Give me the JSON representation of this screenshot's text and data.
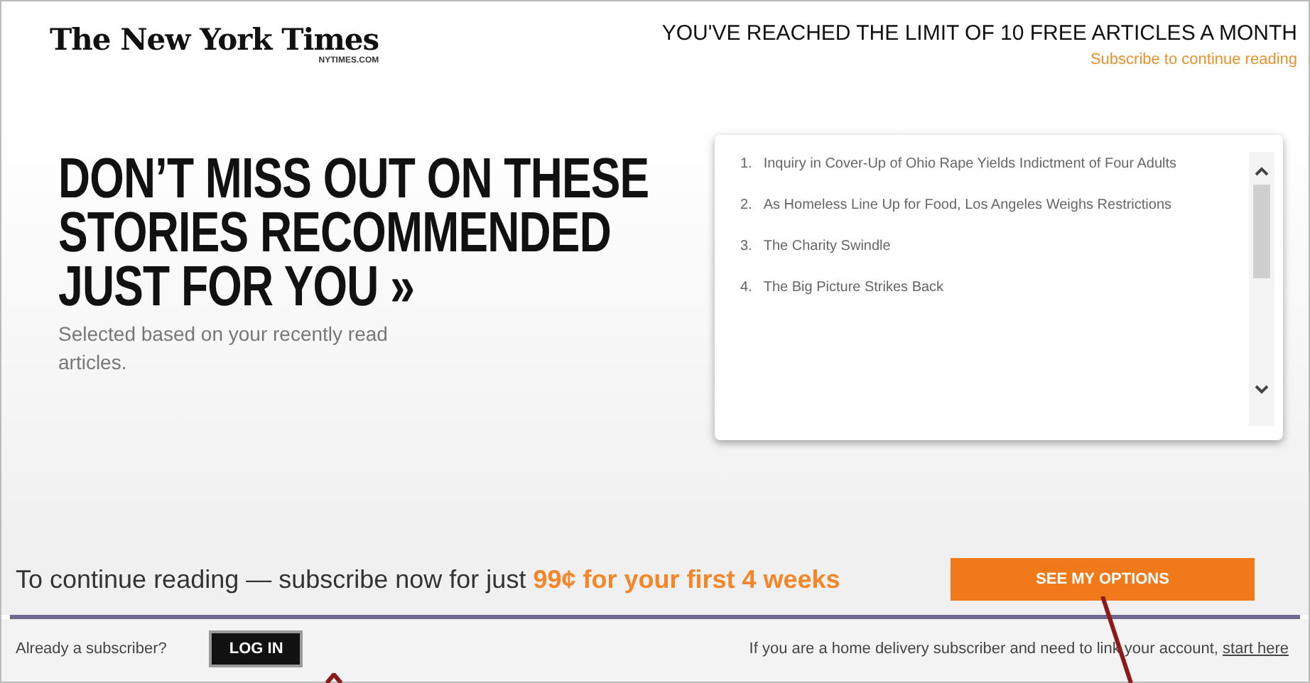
{
  "header": {
    "logo": "The New York Times",
    "logo_sub": "NYTIMES.COM",
    "limit_notice": "YOU'VE REACHED THE LIMIT OF 10 FREE ARTICLES A MONTH",
    "subscribe_link": "Subscribe to continue reading"
  },
  "promo": {
    "headline": "DON’T MISS OUT ON THESE STORIES RECOMMENDED JUST FOR YOU",
    "chevrons": "»",
    "subtitle": "Selected based on your recently read articles."
  },
  "recommended": [
    {
      "number": "1.",
      "title": "Inquiry in Cover-Up of Ohio Rape Yields Indictment of Four Adults"
    },
    {
      "number": "2.",
      "title": "As Homeless Line Up for Food, Los Angeles Weighs Restrictions"
    },
    {
      "number": "3.",
      "title": "The Charity Swindle"
    },
    {
      "number": "4.",
      "title": "The Big Picture Strikes Back"
    }
  ],
  "offer": {
    "text": "To continue reading — subscribe now for just ",
    "highlight": "99¢ for your first 4 weeks",
    "button": "SEE MY OPTIONS"
  },
  "footer": {
    "subscriber_question": "Already a subscriber?",
    "login_button": "LOG IN",
    "delivery_note": "If you are a home delivery subscriber and need to link your account,",
    "delivery_link": "start here"
  }
}
